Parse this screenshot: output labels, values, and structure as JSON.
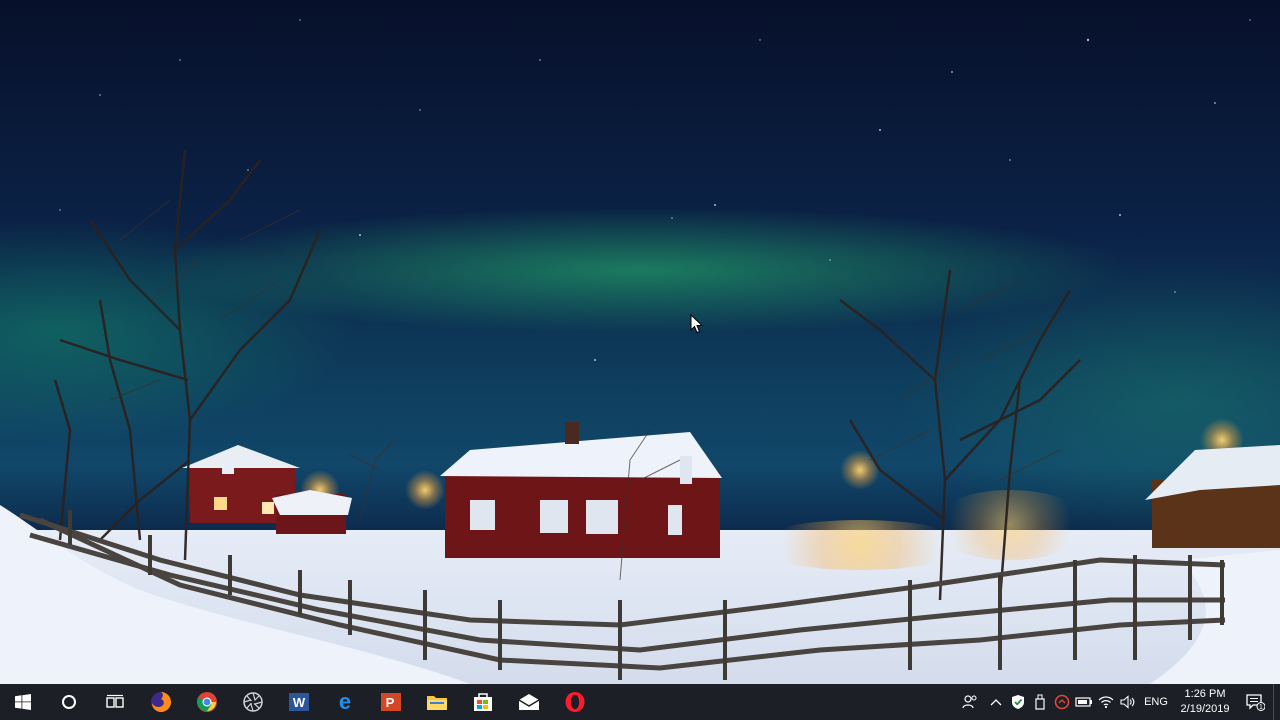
{
  "desktop": {
    "wallpaper": "northern lights over snowy village at night"
  },
  "taskbar": {
    "start_icon": "windows-logo-icon",
    "pinned": [
      {
        "name": "cortana-search",
        "icon": "circle-icon"
      },
      {
        "name": "task-view",
        "icon": "task-view-icon"
      },
      {
        "name": "firefox",
        "icon": "firefox-icon"
      },
      {
        "name": "chrome",
        "icon": "chrome-icon"
      },
      {
        "name": "gear-app",
        "icon": "aperture-icon"
      },
      {
        "name": "word",
        "icon": "word-icon",
        "letter": "W"
      },
      {
        "name": "edge",
        "icon": "edge-icon",
        "letter": "e"
      },
      {
        "name": "powerpoint",
        "icon": "powerpoint-icon",
        "letter": "P"
      },
      {
        "name": "file-explorer",
        "icon": "folder-icon"
      },
      {
        "name": "store",
        "icon": "store-icon"
      },
      {
        "name": "mail",
        "icon": "mail-icon"
      },
      {
        "name": "opera",
        "icon": "opera-icon"
      }
    ],
    "tray": {
      "language": "ENG",
      "time": "1:26 PM",
      "date": "2/19/2019",
      "notification_count": "1"
    },
    "colors": {
      "background": "#1c1f26",
      "accent": "#7aa7d8"
    }
  }
}
